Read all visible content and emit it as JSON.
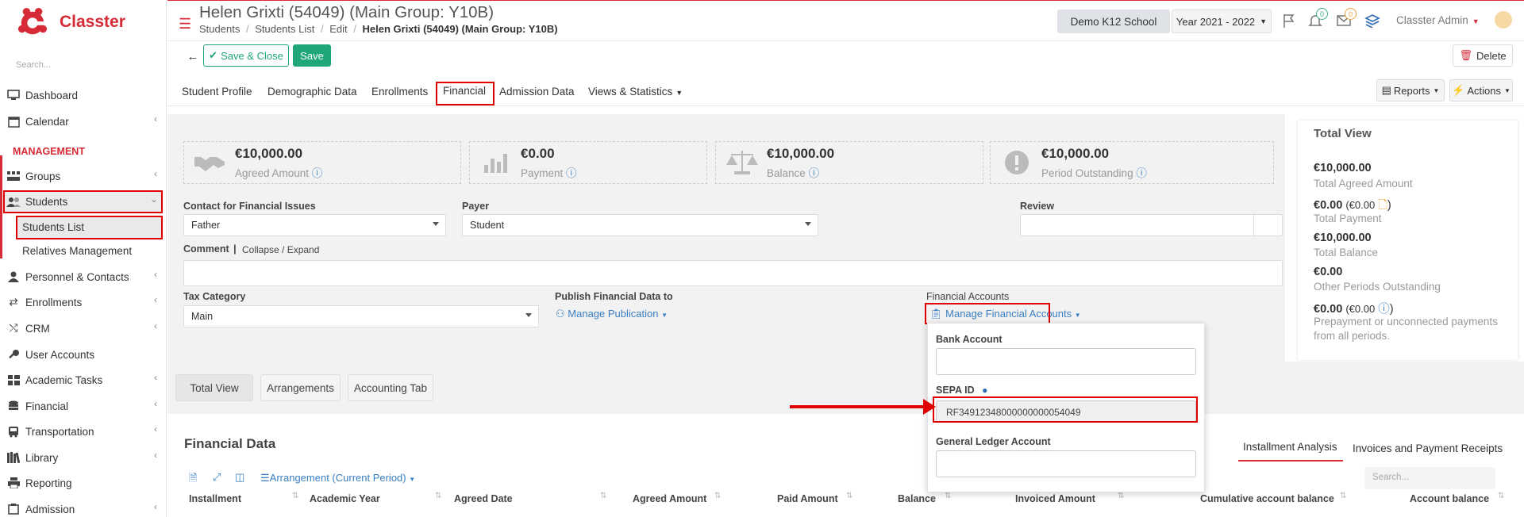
{
  "app": {
    "name": "Classter"
  },
  "sidebar": {
    "search_placeholder": "Search...",
    "section_management": "MANAGEMENT",
    "items": [
      {
        "label": "Dashboard",
        "icon": "monitor-icon"
      },
      {
        "label": "Calendar",
        "icon": "calendar-icon"
      },
      {
        "label": "Groups",
        "icon": "groups-icon"
      },
      {
        "label": "Students",
        "icon": "students-icon"
      },
      {
        "label": "Personnel & Contacts",
        "icon": "person-icon"
      },
      {
        "label": "Enrollments",
        "icon": "exchange-icon"
      },
      {
        "label": "CRM",
        "icon": "crm-icon"
      },
      {
        "label": "User Accounts",
        "icon": "key-icon"
      },
      {
        "label": "Academic Tasks",
        "icon": "grid-icon"
      },
      {
        "label": "Financial",
        "icon": "coins-icon"
      },
      {
        "label": "Transportation",
        "icon": "bus-icon"
      },
      {
        "label": "Library",
        "icon": "books-icon"
      },
      {
        "label": "Reporting",
        "icon": "print-icon"
      },
      {
        "label": "Admission",
        "icon": "admission-icon"
      }
    ],
    "students_sub": [
      "Students List",
      "Relatives Management"
    ]
  },
  "header": {
    "title": "Helen Grixti (54049) (Main Group: Y10B)",
    "breadcrumb": [
      "Students",
      "Students List",
      "Edit",
      "Helen Grixti (54049) (Main Group: Y10B)"
    ],
    "school": "Demo K12 School",
    "year": "Year 2021 - 2022",
    "notif_count": "0",
    "mail_count": "0",
    "user": "Classter Admin"
  },
  "toolbar": {
    "save_close": "Save & Close",
    "save": "Save",
    "delete": "Delete",
    "reports": "Reports",
    "actions": "Actions"
  },
  "tabs": [
    "Student Profile",
    "Demographic Data",
    "Enrollments",
    "Financial",
    "Admission Data",
    "Views & Statistics"
  ],
  "stats": [
    {
      "value": "€10,000.00",
      "label": "Agreed Amount"
    },
    {
      "value": "€0.00",
      "label": "Payment"
    },
    {
      "value": "€10,000.00",
      "label": "Balance"
    },
    {
      "value": "€10,000.00",
      "label": "Period Outstanding"
    }
  ],
  "form": {
    "contact_label": "Contact for Financial Issues",
    "contact_value": "Father",
    "payer_label": "Payer",
    "payer_value": "Student",
    "review_label": "Review",
    "comment_label": "Comment",
    "comment_toggle": "Collapse / Expand",
    "tax_label": "Tax Category",
    "tax_value": "Main",
    "publish_label": "Publish Financial Data to",
    "publish_link": "Manage Publication",
    "accounts_label": "Financial Accounts",
    "accounts_link": "Manage Financial Accounts"
  },
  "dropdown": {
    "bank_label": "Bank Account",
    "sepa_label": "SEPA ID",
    "sepa_value": "RF34912348000000000054049",
    "ledger_label": "General Ledger Account"
  },
  "total_view": {
    "title": "Total View",
    "rows": [
      {
        "value": "€10,000.00",
        "label": "Total Agreed Amount"
      },
      {
        "value": "€0.00",
        "extra": "(€0.00",
        "label": "Total Payment"
      },
      {
        "value": "€10,000.00",
        "label": "Total Balance"
      },
      {
        "value": "€0.00",
        "label": "Other Periods Outstanding"
      },
      {
        "value": "€0.00",
        "extra": "(€0.00",
        "label": "Prepayment or unconnected payments from all periods."
      }
    ]
  },
  "subtabs": [
    "Total View",
    "Arrangements",
    "Accounting Tab"
  ],
  "financial_data": {
    "title": "Financial Data",
    "arrangement_link": "Arrangement (Current Period)",
    "right_tabs": [
      "Installment Analysis",
      "Invoices and Payment Receipts"
    ],
    "search_placeholder": "Search...",
    "columns": [
      "Installment",
      "Academic Year",
      "Agreed Date",
      "Agreed Amount",
      "Paid Amount",
      "Balance",
      "Invoiced Amount",
      "Cumulative account balance",
      "Account balance"
    ]
  },
  "colors": {
    "brand": "#d62b37",
    "primary": "#1fa67a",
    "link": "#3a7fc1",
    "highlight": "#e00000"
  }
}
